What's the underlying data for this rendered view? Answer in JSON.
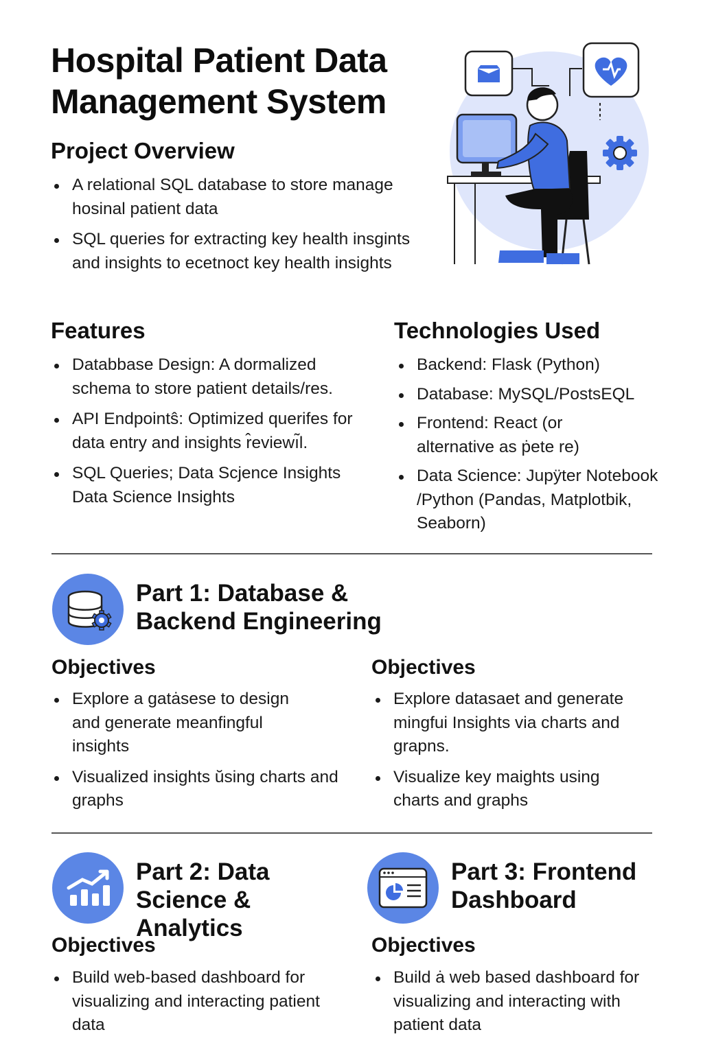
{
  "title": "Hospital Patient Data Management System",
  "colors": {
    "accent": "#5b86e5",
    "accent_light": "#dfe6fb",
    "text": "#111111"
  },
  "overview": {
    "heading": "Project Overview",
    "items": [
      "A relational SQL database to store manage hosinal patient data",
      "SQL queries for extracting key health insgints and insights to ecetnoct key health insights"
    ]
  },
  "features": {
    "heading": "Features",
    "items": [
      "Databbase Design: A dormalized schema to store patient details/res.",
      "API Endpointŝ: Optimized querifes for data entry and insights r̂eviewı͂l.",
      "SQL Queries; Data Scjence Insights Data Science Insights"
    ]
  },
  "technologies": {
    "heading": "Technologies Used",
    "items": [
      "Backend: Flask (Python)",
      "Database: MySQL/PostsEQL",
      "Frontend: React (or alternative as ṗete re)",
      "Data Science: Jupÿter Notebook /Python (Pandas, Matplotbik, Seaborn)"
    ]
  },
  "part1": {
    "title": "Part 1: Database & Backend Engineering",
    "icon": "database-gear-icon",
    "left": {
      "heading": "Objectives",
      "items": [
        "Explore a gatȧsese to design and generate meanfingful insights",
        "Visualized insights ŭsing charts and graphs"
      ]
    },
    "right": {
      "heading": "Objectives",
      "items": [
        "Explore datasaet and generate mingfui Insights via charts and grapns.",
        "Visualize key maights using charts and graphs"
      ]
    }
  },
  "part2": {
    "title": "Part 2: Data Science & Analytics",
    "icon": "bar-chart-trend-icon",
    "heading": "Objectives",
    "items": [
      "Build web-based dashboard for visualizing and interacting patient data"
    ]
  },
  "part3": {
    "title": "Part 3: Frontend Dashboard",
    "icon": "dashboard-window-icon",
    "heading": "Objectives",
    "items": [
      "Build ȧ web based dashboard for visualizing and interacting with patient data"
    ]
  },
  "illustration": {
    "icons": [
      "email-icon",
      "heart-icon",
      "gear-icon",
      "computer-icon",
      "person-at-desk-icon"
    ]
  }
}
